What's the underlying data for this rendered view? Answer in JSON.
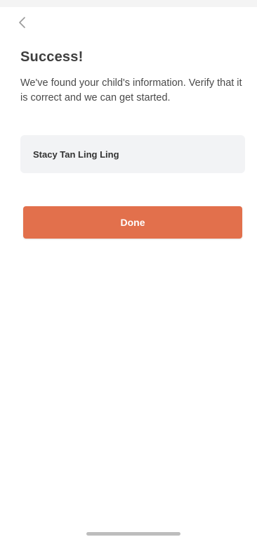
{
  "header": {
    "back_icon": "chevron-left-icon"
  },
  "main": {
    "title": "Success!",
    "subtitle": "We've found your child's information. Verify that it is correct and we can get started.",
    "child_name": "Stacy Tan Ling Ling",
    "done_label": "Done"
  },
  "colors": {
    "accent": "#e2704c",
    "card_background": "#f2f3f5",
    "title_text": "#3f3f3f"
  }
}
